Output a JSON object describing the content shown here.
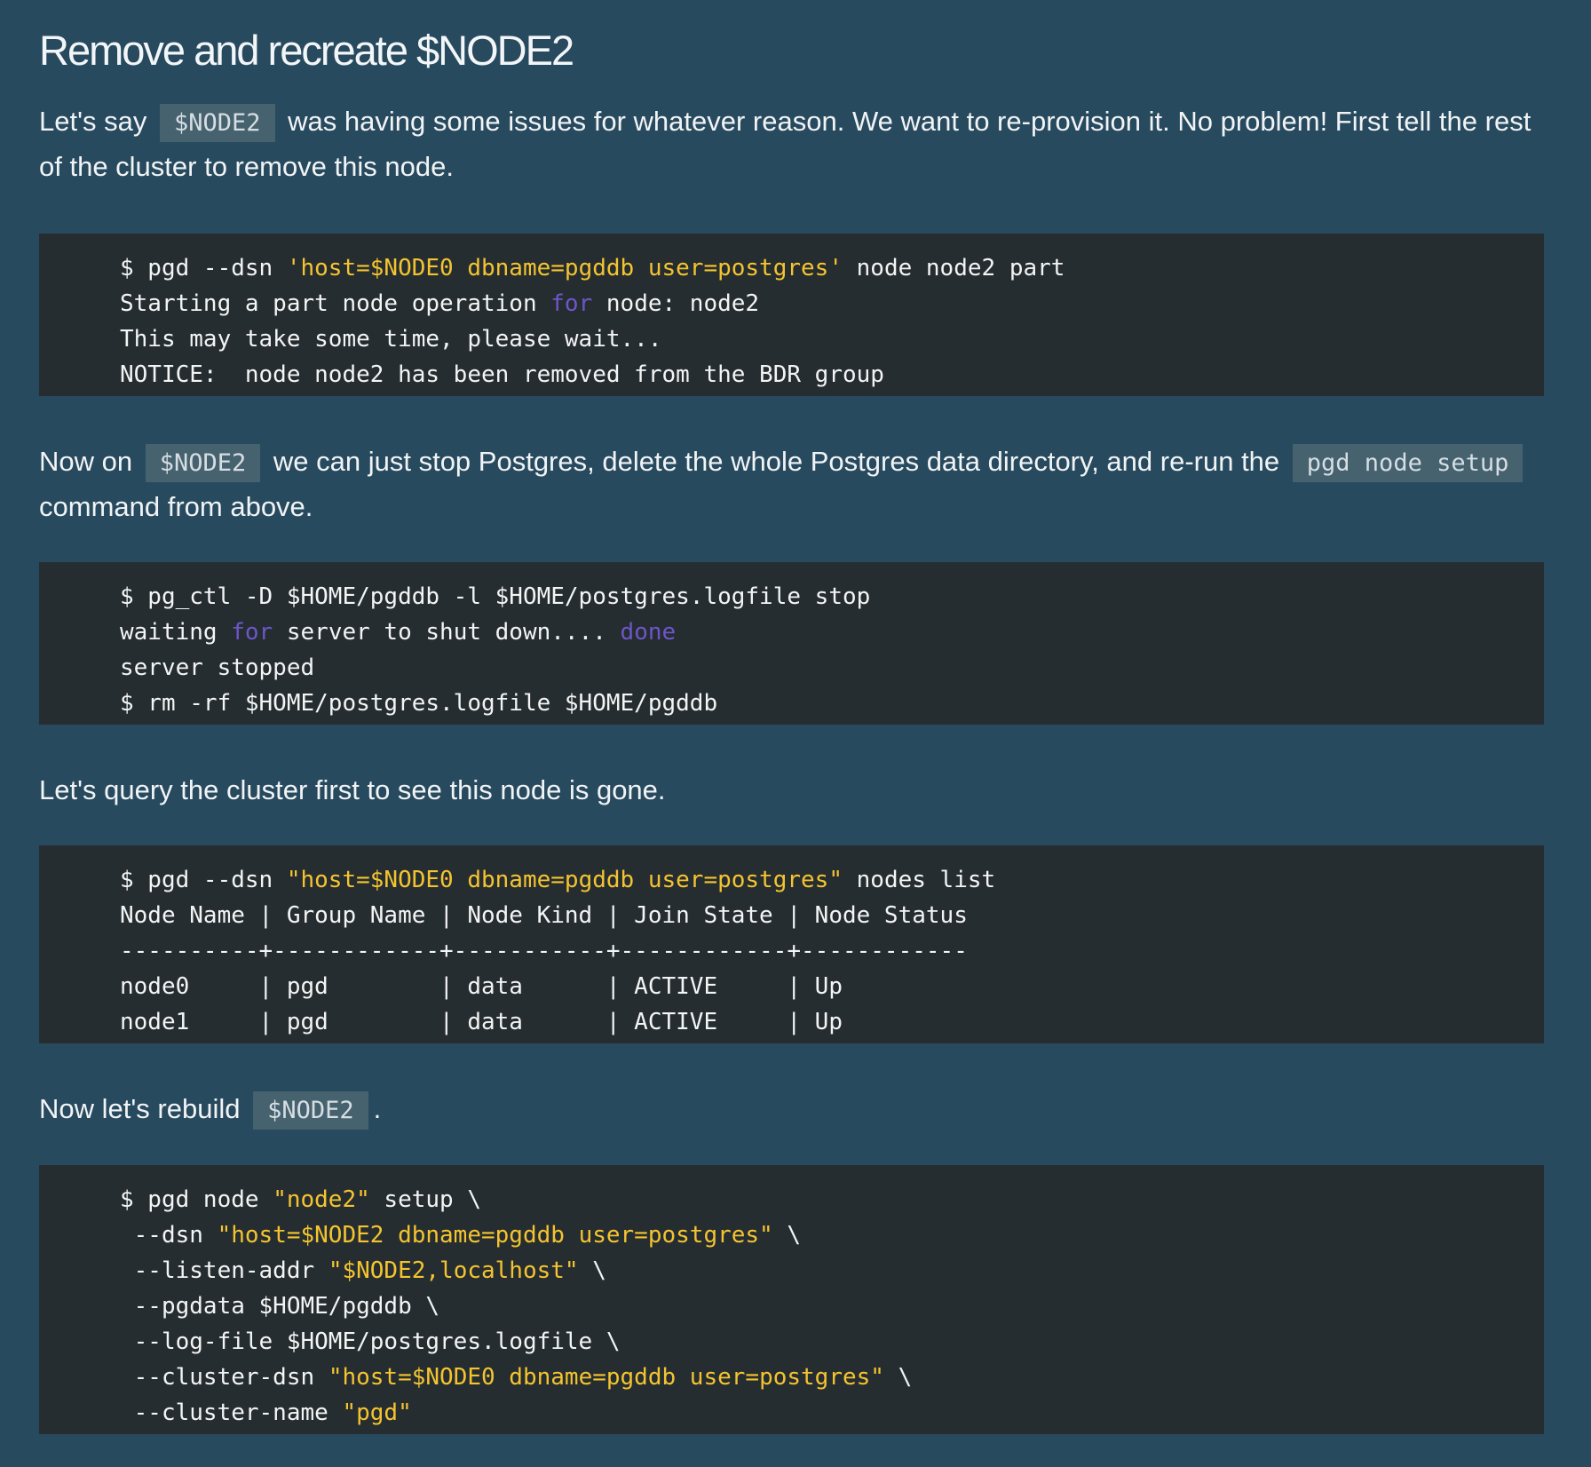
{
  "title": "Remove and recreate $NODE2",
  "para1": {
    "pre": "Let's say ",
    "code": "$NODE2",
    "post": " was having some issues for whatever reason. We want to re-provision it. No problem! First tell the rest of the cluster to remove this node."
  },
  "block1": [
    [
      [
        "p",
        "$ pgd --dsn "
      ],
      [
        "s",
        "'host=$NODE0 dbname=pgddb user=postgres'"
      ],
      [
        "p",
        " node node2 part"
      ]
    ],
    [
      [
        "p",
        "Starting a part node operation "
      ],
      [
        "k",
        "for"
      ],
      [
        "p",
        " node: node2"
      ]
    ],
    [
      [
        "p",
        "This may take some time, please wait..."
      ]
    ],
    [
      [
        "p",
        "NOTICE:  node node2 has been removed from the BDR group"
      ]
    ]
  ],
  "para2": {
    "pre": "Now on ",
    "code1": "$NODE2",
    "mid": " we can just stop Postgres, delete the whole Postgres data directory, and re-run the ",
    "code2": "pgd node setup",
    "post": " command from above."
  },
  "block2": [
    [
      [
        "p",
        "$ pg_ctl -D $HOME/pgddb -l $HOME/postgres.logfile stop"
      ]
    ],
    [
      [
        "p",
        "waiting "
      ],
      [
        "k",
        "for"
      ],
      [
        "p",
        " server to shut down.... "
      ],
      [
        "k",
        "done"
      ]
    ],
    [
      [
        "p",
        "server stopped"
      ]
    ],
    [
      [
        "p",
        "$ rm -rf $HOME/postgres.logfile $HOME/pgddb"
      ]
    ]
  ],
  "para3": {
    "text": "Let's query the cluster first to see this node is gone."
  },
  "block3": [
    [
      [
        "p",
        "$ pgd --dsn "
      ],
      [
        "s",
        "\"host=$NODE0 dbname=pgddb user=postgres\""
      ],
      [
        "p",
        " nodes list"
      ]
    ],
    [
      [
        "p",
        "Node Name | Group Name | Node Kind | Join State | Node Status"
      ]
    ],
    [
      [
        "p",
        "----------+------------+-----------+------------+------------"
      ]
    ],
    [
      [
        "p",
        "node0     | pgd        | data      | ACTIVE     | Up"
      ]
    ],
    [
      [
        "p",
        "node1     | pgd        | data      | ACTIVE     | Up"
      ]
    ]
  ],
  "para4": {
    "pre": "Now let's rebuild ",
    "code": "$NODE2",
    "post": "."
  },
  "block4": [
    [
      [
        "p",
        "$ pgd node "
      ],
      [
        "s",
        "\"node2\""
      ],
      [
        "p",
        " setup \\"
      ]
    ],
    [
      [
        "p",
        " --dsn "
      ],
      [
        "s",
        "\"host=$NODE2 dbname=pgddb user=postgres\""
      ],
      [
        "p",
        " \\"
      ]
    ],
    [
      [
        "p",
        " --listen-addr "
      ],
      [
        "s",
        "\"$NODE2,localhost\""
      ],
      [
        "p",
        " \\"
      ]
    ],
    [
      [
        "p",
        " --pgdata $HOME/pgddb \\"
      ]
    ],
    [
      [
        "p",
        " --log-file $HOME/postgres.logfile \\"
      ]
    ],
    [
      [
        "p",
        " --cluster-dsn "
      ],
      [
        "s",
        "\"host=$NODE0 dbname=pgddb user=postgres\""
      ],
      [
        "p",
        " \\"
      ]
    ],
    [
      [
        "p",
        " --cluster-name "
      ],
      [
        "s",
        "\"pgd\""
      ]
    ]
  ],
  "colors": {
    "page_background": "#284a5e",
    "code_block_background": "#262d30",
    "inline_code_background": "#46626f",
    "string": "#f4c430",
    "keyword": "#6d56c9"
  }
}
